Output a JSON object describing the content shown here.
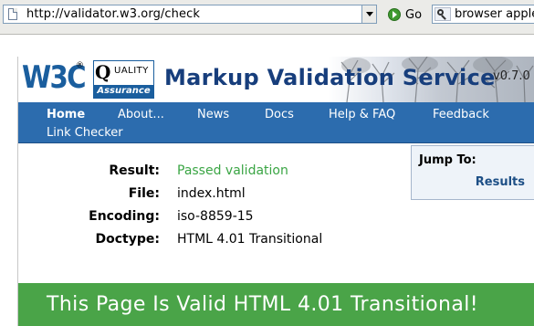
{
  "browser": {
    "url": "http://validator.w3.org/check",
    "go_label": "Go",
    "search_text": "browser apple"
  },
  "banner": {
    "w3c_logo": "W3C",
    "w3c_reg": "®",
    "qa_q": "Q",
    "qa_quality": "UALITY",
    "qa_assurance": "Assurance",
    "title": "Markup Validation Service",
    "version": "v0.7.0"
  },
  "nav": {
    "items": [
      {
        "label": "Home"
      },
      {
        "label": "About..."
      },
      {
        "label": "News"
      },
      {
        "label": "Docs"
      },
      {
        "label": "Help & FAQ"
      },
      {
        "label": "Feedback"
      },
      {
        "label": "Link Checker"
      }
    ]
  },
  "results": [
    {
      "label": "Result:",
      "value": "Passed validation"
    },
    {
      "label": "File:",
      "value": "index.html"
    },
    {
      "label": "Encoding:",
      "value": "iso-8859-15"
    },
    {
      "label": "Doctype:",
      "value": "HTML 4.01 Transitional"
    }
  ],
  "jump": {
    "title": "Jump To:",
    "link": "Results"
  },
  "valid_message": "This Page Is Valid HTML 4.01 Transitional!",
  "colors": {
    "nav_background": "#2c6cae",
    "passed_text": "#3aa544",
    "valid_banner": "#4aa448",
    "title_text": "#173e7c"
  }
}
